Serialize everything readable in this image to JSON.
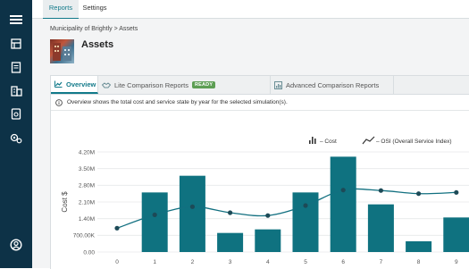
{
  "top_tabs": [
    {
      "label": "Reports",
      "active": true
    },
    {
      "label": "Settings",
      "active": false
    }
  ],
  "sidebar": {
    "items": [
      {
        "icon": "hamburger-menu-icon"
      },
      {
        "icon": "inventory-icon"
      },
      {
        "icon": "document-icon"
      },
      {
        "icon": "buildings-icon"
      },
      {
        "icon": "report-icon"
      },
      {
        "icon": "settings-gears-icon"
      },
      {
        "icon": "user-account-icon"
      }
    ]
  },
  "breadcrumb": {
    "text": "Municipality of Brightly > Assets"
  },
  "page": {
    "title": "Assets"
  },
  "report_tabs": [
    {
      "label": "Overview",
      "icon": "chart-area-icon",
      "active": true
    },
    {
      "label": "Lite Comparison Reports",
      "icon": "handshake-icon",
      "badge": "READY",
      "active": false
    },
    {
      "label": "Advanced Comparison Reports",
      "icon": "advanced-chart-icon",
      "active": false
    }
  ],
  "info": {
    "text": "Overview shows the total cost and service state by year for the selected simulation(s)."
  },
  "colors": {
    "bar": "#0f7280",
    "line": "#127080",
    "accent": "#127a8a",
    "sidebar": "#0d3247",
    "badge": "#5d9e54"
  },
  "chart_data": {
    "type": "bar",
    "categories": [
      "0",
      "1",
      "2",
      "3",
      "4",
      "5",
      "6",
      "7",
      "8",
      "9"
    ],
    "ylabel": "Cost $",
    "yticks": [
      "0.00",
      "700.00K",
      "1.40M",
      "2.10M",
      "2.80M",
      "3.50M",
      "4.20M"
    ],
    "ylim": [
      0,
      4200000
    ],
    "legend_position": "top-right",
    "series": [
      {
        "name": "– Cost",
        "type": "bar",
        "values": [
          0,
          2500000,
          3200000,
          800000,
          950000,
          2500000,
          4000000,
          2000000,
          450000,
          1450000
        ]
      },
      {
        "name": "– OSI (Overall Service Index)",
        "type": "line",
        "values": [
          1000000,
          1560000,
          1900000,
          1650000,
          1530000,
          1950000,
          2600000,
          2580000,
          2450000,
          2500000
        ]
      }
    ]
  }
}
